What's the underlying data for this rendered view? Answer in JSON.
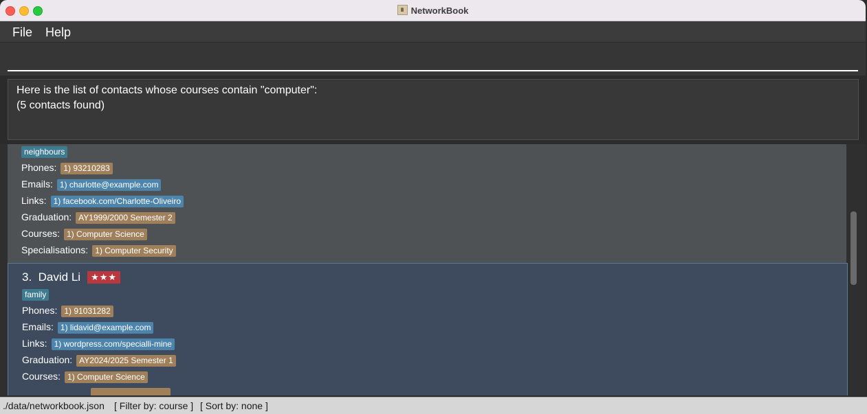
{
  "window": {
    "title": "NetworkBook"
  },
  "menu": {
    "file": "File",
    "help": "Help"
  },
  "command": {
    "value": ""
  },
  "result": {
    "line1": "Here is the list of contacts whose courses contain \"computer\":",
    "line2": "(5 contacts found)"
  },
  "contacts": [
    {
      "tag": "neighbours",
      "phones_label": "Phones:",
      "phone": "1) 93210283",
      "emails_label": "Emails:",
      "email": "1) charlotte@example.com",
      "links_label": "Links:",
      "link": "1) facebook.com/Charlotte-Oliveiro",
      "graduation_label": "Graduation:",
      "graduation": "AY1999/2000 Semester 2",
      "courses_label": "Courses:",
      "course": "1) Computer Science",
      "specialisations_label": "Specialisations:",
      "specialisation": "1) Computer Security"
    },
    {
      "index": "3.",
      "name": "David Li",
      "priority": "★★★",
      "tag": "family",
      "phones_label": "Phones:",
      "phone": "1) 91031282",
      "emails_label": "Emails:",
      "email": "1) lidavid@example.com",
      "links_label": "Links:",
      "link": "1) wordpress.com/specialli-mine",
      "graduation_label": "Graduation:",
      "graduation": "AY2024/2025 Semester 1",
      "courses_label": "Courses:",
      "course": "1) Computer Science"
    }
  ],
  "status": {
    "path": "./data/networkbook.json",
    "filter": "[ Filter by: course ]",
    "sort": "[ Sort by: none ]"
  },
  "colors": {
    "chip_tan": "#a0805a",
    "chip_blue": "#4d84ab",
    "chip_teal": "#3e7b91",
    "priority_red": "#b8383e"
  }
}
